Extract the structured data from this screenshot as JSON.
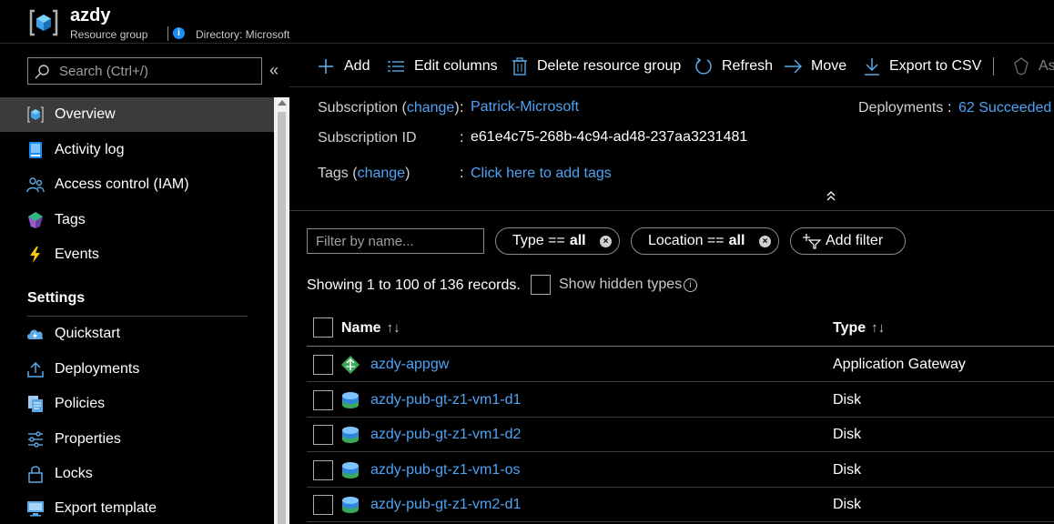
{
  "header": {
    "title": "azdy",
    "subtitle": "Resource group",
    "info_icon_text": "i",
    "directory": "Directory: Microsoft"
  },
  "sidebar": {
    "search_placeholder": "Search (Ctrl+/)",
    "collapse_glyph": "«",
    "items": [
      {
        "label": "Overview",
        "icon": "overview-icon",
        "active": true
      },
      {
        "label": "Activity log",
        "icon": "activity-log-icon"
      },
      {
        "label": "Access control (IAM)",
        "icon": "people-icon"
      },
      {
        "label": "Tags",
        "icon": "tag-icon"
      },
      {
        "label": "Events",
        "icon": "lightning-icon"
      }
    ],
    "settings_heading": "Settings",
    "settings_items": [
      {
        "label": "Quickstart",
        "icon": "cloud-icon"
      },
      {
        "label": "Deployments",
        "icon": "upload-icon"
      },
      {
        "label": "Policies",
        "icon": "policy-icon"
      },
      {
        "label": "Properties",
        "icon": "sliders-icon"
      },
      {
        "label": "Locks",
        "icon": "lock-icon"
      },
      {
        "label": "Export template",
        "icon": "monitor-icon"
      }
    ]
  },
  "toolbar": {
    "add": "Add",
    "edit_columns": "Edit columns",
    "delete": "Delete resource group",
    "refresh": "Refresh",
    "move": "Move",
    "export_csv": "Export to CSV",
    "overflow": "As"
  },
  "essentials": {
    "subscription_key": "Subscription (",
    "subscription_change": "change",
    "subscription_close": ")",
    "colon": ":",
    "subscription_value": "Patrick-Microsoft",
    "subscription_id_key": "Subscription ID",
    "subscription_id_value": "e61e4c75-268b-4c94-ad48-237aa3231481",
    "tags_key": "Tags (",
    "tags_change": "change",
    "tags_close": ")",
    "tags_value": "Click here to add tags",
    "deployments_key": "Deployments",
    "deployments_value": "62 Succeeded"
  },
  "filters": {
    "name_placeholder": "Filter by name...",
    "type_prefix": "Type ==",
    "type_value": "all",
    "location_prefix": "Location ==",
    "location_value": "all",
    "clear_glyph": "×",
    "add_filter": "Add filter"
  },
  "records": {
    "showing": "Showing 1 to 100 of 136 records.",
    "show_hidden": "Show hidden types",
    "info_glyph": "i"
  },
  "table": {
    "col_name": "Name",
    "col_type": "Type",
    "sort_glyph": "↑↓",
    "rows": [
      {
        "name": "azdy-appgw",
        "type": "Application Gateway",
        "icon": "app-gateway-icon"
      },
      {
        "name": "azdy-pub-gt-z1-vm1-d1",
        "type": "Disk",
        "icon": "disk-icon"
      },
      {
        "name": "azdy-pub-gt-z1-vm1-d2",
        "type": "Disk",
        "icon": "disk-icon"
      },
      {
        "name": "azdy-pub-gt-z1-vm1-os",
        "type": "Disk",
        "icon": "disk-icon"
      },
      {
        "name": "azdy-pub-gt-z1-vm2-d1",
        "type": "Disk",
        "icon": "disk-icon"
      }
    ]
  },
  "colors": {
    "link": "#4fa3f5",
    "accent": "#1b8ef2",
    "active_nav": "#3b3b3b"
  }
}
